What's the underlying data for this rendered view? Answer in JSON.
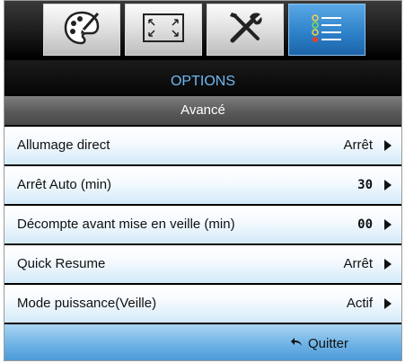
{
  "tabs": [
    {
      "icon": "palette-icon",
      "active": false
    },
    {
      "icon": "display-frame-icon",
      "active": false
    },
    {
      "icon": "tools-icon",
      "active": false
    },
    {
      "icon": "options-list-icon",
      "active": true
    }
  ],
  "menu": {
    "title": "OPTIONS",
    "subtitle": "Avancé"
  },
  "items": [
    {
      "label": "Allumage direct",
      "value": "Arrêt"
    },
    {
      "label": "Arrêt Auto (min)",
      "value": "30"
    },
    {
      "label": "Décompte avant mise en veille (min)",
      "value": "00"
    },
    {
      "label": "Quick Resume",
      "value": "Arrêt"
    },
    {
      "label": "Mode puissance(Veille)",
      "value": "Actif"
    }
  ],
  "footer": {
    "quit_label": "Quitter",
    "quit_icon": "return-arrow-icon"
  },
  "colors": {
    "title_text": "#6fb8f2",
    "active_tab": "#2b7fc7",
    "footer": "#6fb3e6"
  }
}
